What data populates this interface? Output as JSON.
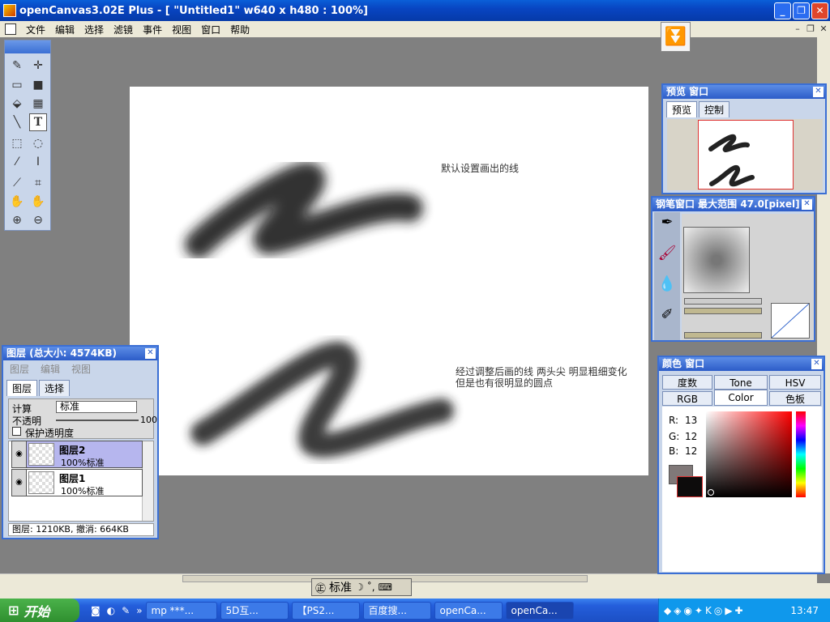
{
  "window": {
    "title": "openCanvas3.02E Plus - [ \"Untitled1\" w640 x h480 : 100%]"
  },
  "menu": [
    "文件",
    "编辑",
    "选择",
    "滤镜",
    "事件",
    "视图",
    "窗口",
    "帮助"
  ],
  "canvas": {
    "note1": "默认设置画出的线",
    "note2_line1": "经过调整后画的线 两头尖 明显粗细变化",
    "note2_line2": "但是也有很明显的圆点"
  },
  "layers_panel": {
    "title": "图层 (总大小: 4574KB)",
    "menu": [
      "图层",
      "编辑",
      "视图"
    ],
    "tabs": [
      "图层",
      "选择"
    ],
    "calc_label": "计算",
    "calc_value": "标准",
    "opacity_label": "不透明",
    "opacity_value": "100",
    "protect_label": "保护透明度",
    "layers": [
      {
        "name": "图层2",
        "mode": "100%标准"
      },
      {
        "name": "图层1",
        "mode": "100%标准"
      }
    ],
    "status": "图层: 1210KB, 撤消: 664KB"
  },
  "preview_panel": {
    "title": "预览 窗口",
    "tabs": [
      "预览",
      "控制"
    ]
  },
  "brush_panel": {
    "title": "钢笔窗口  最大范围 47.0[pixel]"
  },
  "color_panel": {
    "title": "颜色 窗口",
    "tabs_row1": [
      "度数",
      "Tone",
      "HSV"
    ],
    "tabs_row2": [
      "RGB",
      "Color",
      "色板"
    ],
    "r_label": "R:",
    "r": "13",
    "g_label": "G:",
    "g": "12",
    "b_label": "B:",
    "b": "12",
    "fg_color": "#0d0c0c"
  },
  "bottom_toolbar": {
    "label": "标准"
  },
  "taskbar": {
    "start": "开始",
    "items": [
      "mp ***...",
      "5D互...",
      "【PS2...",
      "百度搜...",
      "openCa...",
      "openCa..."
    ],
    "clock": "13:47"
  }
}
